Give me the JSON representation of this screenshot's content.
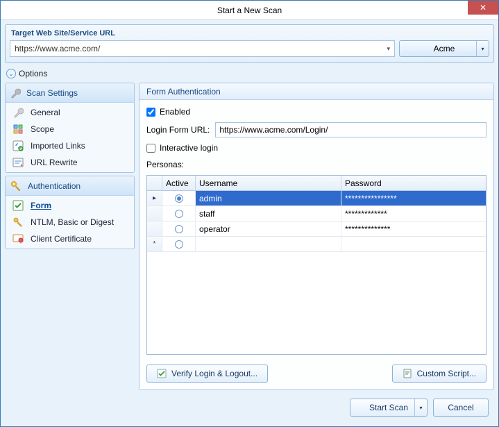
{
  "window": {
    "title": "Start a New Scan"
  },
  "url_panel": {
    "label": "Target Web Site/Service URL",
    "value": "https://www.acme.com/",
    "profile_button": "Acme"
  },
  "options_label": "Options",
  "sidebar": {
    "group1": {
      "header": "Scan Settings",
      "items": [
        "General",
        "Scope",
        "Imported Links",
        "URL Rewrite"
      ]
    },
    "group2": {
      "header": "Authentication",
      "items": [
        "Form",
        "NTLM, Basic or Digest",
        "Client Certificate"
      ],
      "selected_index": 0
    }
  },
  "main": {
    "header": "Form Authentication",
    "enabled_label": "Enabled",
    "enabled_checked": true,
    "login_url_label": "Login Form URL:",
    "login_url_value": "https://www.acme.com/Login/",
    "interactive_label": "Interactive login",
    "interactive_checked": false,
    "personas_label": "Personas:",
    "columns": {
      "active": "Active",
      "username": "Username",
      "password": "Password"
    },
    "rows": [
      {
        "active": true,
        "username": "admin",
        "password": "****************",
        "selected": true,
        "current": true
      },
      {
        "active": false,
        "username": "staff",
        "password": "*************",
        "selected": false
      },
      {
        "active": false,
        "username": "operator",
        "password": "**************",
        "selected": false
      }
    ],
    "buttons": {
      "verify": "Verify Login & Logout...",
      "custom": "Custom Script..."
    }
  },
  "footer": {
    "start": "Start Scan",
    "cancel": "Cancel"
  }
}
